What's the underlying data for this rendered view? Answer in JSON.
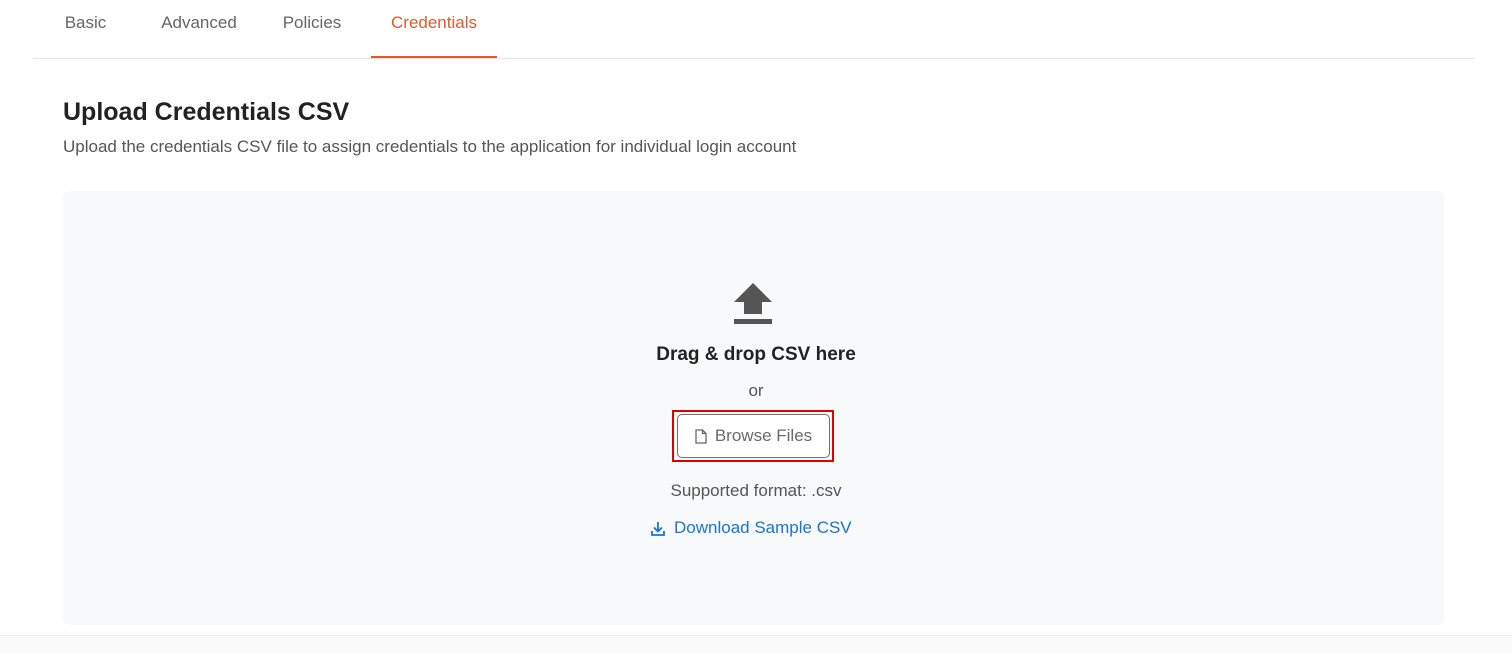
{
  "tabs": [
    {
      "label": "Basic",
      "active": false
    },
    {
      "label": "Advanced",
      "active": false
    },
    {
      "label": "Policies",
      "active": false
    },
    {
      "label": "Credentials",
      "active": true
    }
  ],
  "header": {
    "title": "Upload Credentials CSV",
    "subtitle": "Upload the credentials CSV file to assign credentials to the application for individual login account"
  },
  "dropzone": {
    "icon": "upload-icon",
    "title": "Drag & drop CSV here",
    "or_text": "or",
    "browse_button": {
      "label": "Browse Files",
      "icon": "file-icon"
    },
    "supported_text": "Supported format: .csv",
    "download_link": {
      "label": "Download Sample CSV",
      "icon": "download-icon"
    }
  },
  "colors": {
    "accent": "#e05a2b",
    "link": "#1a73d9",
    "highlight": "#e00000",
    "dropzone_bg": "#f8f9fa"
  }
}
